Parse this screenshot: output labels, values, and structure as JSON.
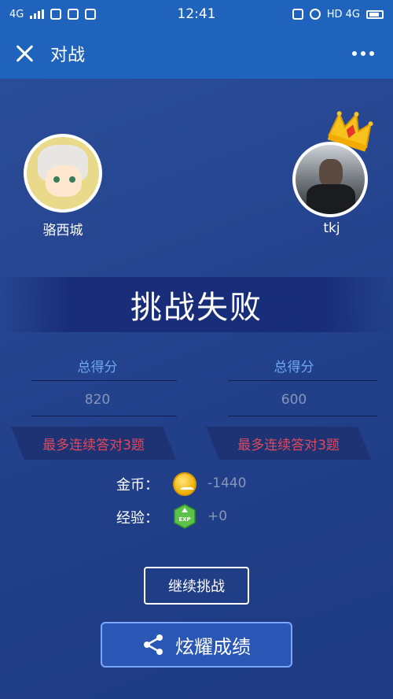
{
  "statusbar": {
    "network": "4G",
    "time": "12:41",
    "right_text": "HD 4G"
  },
  "navbar": {
    "title": "对战"
  },
  "players": [
    {
      "name": "骆西城"
    },
    {
      "name": "tkj"
    }
  ],
  "result": {
    "title": "挑战失败"
  },
  "scores": {
    "label": "总得分",
    "left_value": "820",
    "right_value": "600"
  },
  "streak": {
    "left": "最多连续答对3题",
    "right": "最多连续答对3题"
  },
  "rewards": {
    "coin_label": "金币：",
    "coin_value": "-1440",
    "exp_label": "经验：",
    "exp_value": "+0",
    "exp_badge": "EXP"
  },
  "buttons": {
    "continue": "继续挑战",
    "share": "炫耀成绩"
  },
  "colors": {
    "nav_bg": "#1f63bd",
    "page_bg": "#24418a",
    "score_label": "#6ea7f5",
    "streak_text": "#e0475d",
    "coin": "#f0b000",
    "exp": "#4caf50"
  }
}
